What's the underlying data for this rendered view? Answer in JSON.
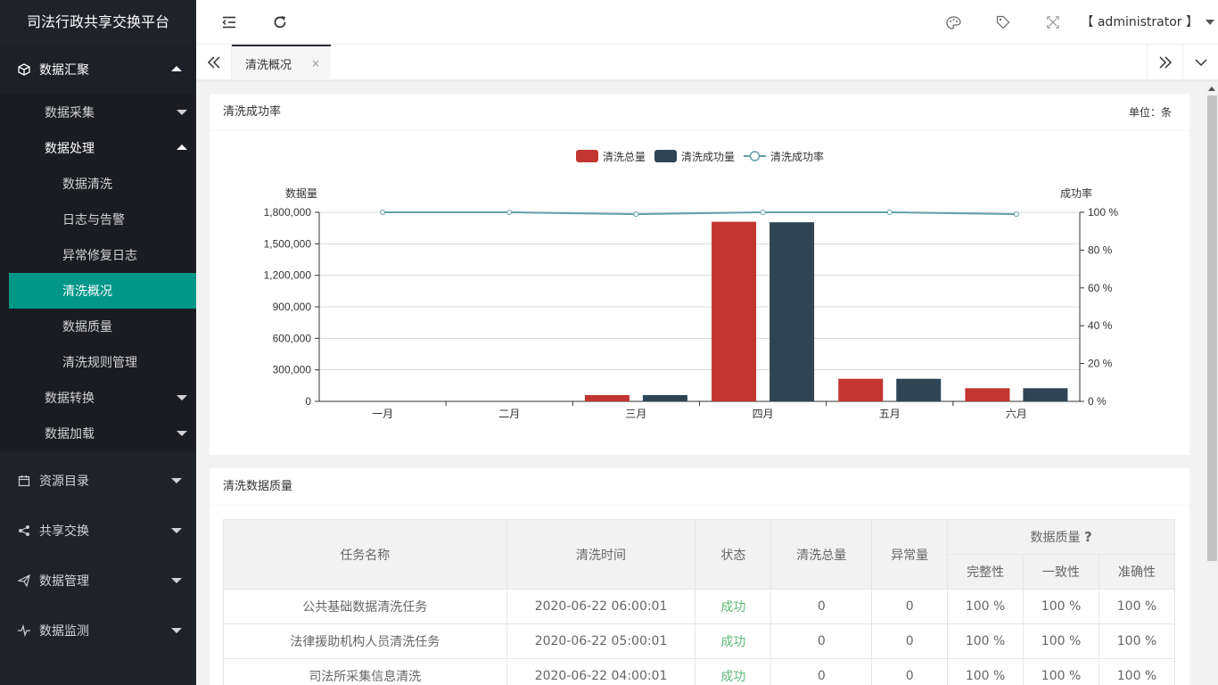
{
  "app": {
    "title": "司法行政共享交换平台"
  },
  "header": {
    "user": "【 administrator 】"
  },
  "sidebar": {
    "groups": [
      {
        "label": "数据汇聚",
        "icon": "cube-icon",
        "open": true,
        "subs": [
          {
            "label": "数据采集",
            "open": false
          },
          {
            "label": "数据处理",
            "open": true,
            "items": [
              "数据清洗",
              "日志与告警",
              "异常修复日志",
              "清洗概况",
              "数据质量",
              "清洗规则管理"
            ]
          },
          {
            "label": "数据转换",
            "open": false
          },
          {
            "label": "数据加载",
            "open": false
          }
        ]
      },
      {
        "label": "资源目录",
        "icon": "calendar-icon"
      },
      {
        "label": "共享交换",
        "icon": "share-icon"
      },
      {
        "label": "数据管理",
        "icon": "send-icon"
      },
      {
        "label": "数据监测",
        "icon": "pulse-icon"
      }
    ],
    "active_item": "清洗概况"
  },
  "tabs": [
    {
      "label": "清洗概况",
      "close": "×"
    }
  ],
  "chart_card": {
    "title": "清洗成功率",
    "unit": "单位：条"
  },
  "chart_data": {
    "type": "bar",
    "categories": [
      "一月",
      "二月",
      "三月",
      "四月",
      "五月",
      "六月"
    ],
    "series": [
      {
        "name": "清洗总量",
        "type": "bar",
        "color": "#c23531",
        "values": [
          0,
          0,
          60000,
          1710000,
          215000,
          125000
        ]
      },
      {
        "name": "清洗成功量",
        "type": "bar",
        "color": "#2f4554",
        "values": [
          0,
          0,
          60000,
          1705000,
          215000,
          125000
        ]
      },
      {
        "name": "清洗成功率",
        "type": "line",
        "color": "#61a0a8",
        "axis": "right",
        "values": [
          100,
          100,
          99,
          100,
          100,
          99
        ]
      }
    ],
    "ylabel": "数据量",
    "ylabel_right": "成功率",
    "ylim": [
      0,
      1800000
    ],
    "ylim_right": [
      0,
      100
    ],
    "yticks": [
      "0",
      "300,000",
      "600,000",
      "900,000",
      "1,200,000",
      "1,500,000",
      "1,800,000"
    ],
    "yticks_right": [
      "0 %",
      "20 %",
      "40 %",
      "60 %",
      "80 %",
      "100 %"
    ],
    "legend": "top-center",
    "grid": true
  },
  "quality_card": {
    "title": "清洗数据质量",
    "columns": {
      "name": "任务名称",
      "time": "清洗时间",
      "status": "状态",
      "total": "清洗总量",
      "abnormal": "异常量",
      "quality": "数据质量",
      "quality_help": "?",
      "completeness": "完整性",
      "consistency": "一致性",
      "accuracy": "准确性"
    },
    "rows": [
      {
        "name": "公共基础数据清洗任务",
        "time": "2020-06-22 06:00:01",
        "status": "成功",
        "total": "0",
        "abnormal": "0",
        "completeness": "100 %",
        "consistency": "100 %",
        "accuracy": "100 %"
      },
      {
        "name": "法律援助机构人员清洗任务",
        "time": "2020-06-22 05:00:01",
        "status": "成功",
        "total": "0",
        "abnormal": "0",
        "completeness": "100 %",
        "consistency": "100 %",
        "accuracy": "100 %"
      },
      {
        "name": "司法所采集信息清洗",
        "time": "2020-06-22 04:00:01",
        "status": "成功",
        "total": "0",
        "abnormal": "0",
        "completeness": "100 %",
        "consistency": "100 %",
        "accuracy": "100 %"
      }
    ]
  }
}
